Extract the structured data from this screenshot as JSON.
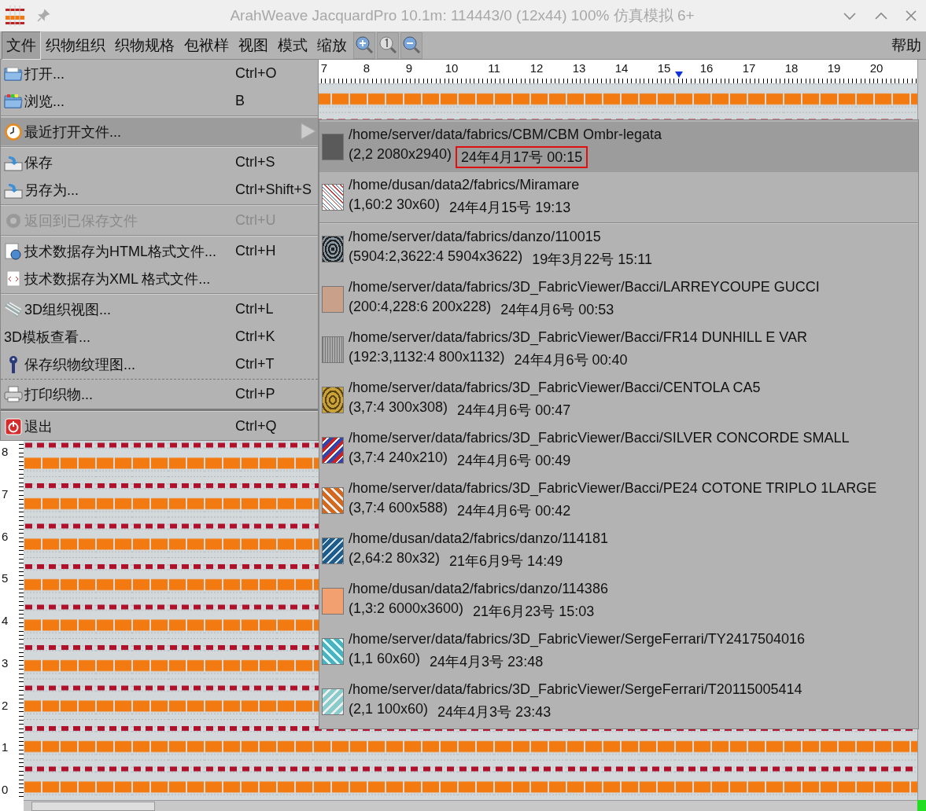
{
  "window": {
    "title": "ArahWeave JacquardPro 10.1m: 114443/0 (12x44) 100% 仿真模拟 6+"
  },
  "menubar": {
    "items": [
      {
        "label": "文件",
        "selected": true
      },
      {
        "label": "织物组织",
        "selected": false
      },
      {
        "label": "织物规格",
        "selected": false
      },
      {
        "label": "包袱样",
        "selected": false
      },
      {
        "label": "视图",
        "selected": false
      },
      {
        "label": "模式",
        "selected": false
      },
      {
        "label": "缩放",
        "selected": false
      }
    ],
    "help": "帮助"
  },
  "top_ruler": {
    "labels": [
      "7",
      "8",
      "9",
      "10",
      "11",
      "12",
      "13",
      "14",
      "15",
      "16",
      "17",
      "18",
      "19",
      "20"
    ]
  },
  "left_ruler": {
    "labels": [
      "8",
      "7",
      "6",
      "5",
      "4",
      "3",
      "2",
      "1",
      "0"
    ]
  },
  "file_menu": [
    {
      "kind": "item",
      "label": "打开...",
      "shortcut": "Ctrl+O",
      "disabled": false,
      "selected": false,
      "submenu": false
    },
    {
      "kind": "item",
      "label": "浏览...",
      "shortcut": "B",
      "disabled": false,
      "selected": false,
      "submenu": false
    },
    {
      "kind": "separator"
    },
    {
      "kind": "item",
      "label": "最近打开文件...",
      "disabled": false,
      "selected": true,
      "submenu": true
    },
    {
      "kind": "separator"
    },
    {
      "kind": "item",
      "label": "保存",
      "shortcut": "Ctrl+S",
      "disabled": false,
      "selected": false,
      "submenu": false
    },
    {
      "kind": "item",
      "label": "另存为...",
      "shortcut": "Ctrl+Shift+S",
      "disabled": false,
      "selected": false,
      "submenu": false
    },
    {
      "kind": "separator"
    },
    {
      "kind": "item",
      "label": "返回到已保存文件",
      "shortcut": "Ctrl+U",
      "disabled": true,
      "selected": false,
      "submenu": false
    },
    {
      "kind": "separator"
    },
    {
      "kind": "item",
      "label": "技术数据存为HTML格式文件...",
      "shortcut": "Ctrl+H",
      "disabled": false,
      "selected": false,
      "submenu": false
    },
    {
      "kind": "item",
      "label": "技术数据存为XML 格式文件...",
      "disabled": false,
      "selected": false,
      "submenu": false
    },
    {
      "kind": "separator"
    },
    {
      "kind": "item",
      "label": "3D组织视图...",
      "shortcut": "Ctrl+L",
      "disabled": false,
      "selected": false,
      "submenu": false
    },
    {
      "kind": "item",
      "label": "3D模板查看...",
      "shortcut": "Ctrl+K",
      "disabled": false,
      "selected": false,
      "submenu": false
    },
    {
      "kind": "item",
      "label": "保存织物纹理图...",
      "shortcut": "Ctrl+T",
      "disabled": false,
      "selected": false,
      "submenu": false
    },
    {
      "kind": "dashed-separator"
    },
    {
      "kind": "item",
      "label": "打印织物...",
      "shortcut": "Ctrl+P",
      "disabled": false,
      "selected": false,
      "submenu": false
    },
    {
      "kind": "heavy-separator"
    },
    {
      "kind": "item",
      "label": "退出",
      "shortcut": "Ctrl+Q",
      "disabled": false,
      "selected": false,
      "submenu": false
    }
  ],
  "recent_files": [
    {
      "path": "/home/server/data/fabrics/CBM/CBM Ombr-legata",
      "details": "(2,2 2080x2940)",
      "date": "24年4月17号 00:15",
      "selected": true,
      "marked": true,
      "divider_after": false
    },
    {
      "path": "/home/dusan/data2/fabrics/Miramare",
      "details": "(1,60:2 30x60)",
      "date": "24年4月15号 19:13",
      "selected": false,
      "marked": false,
      "divider_after": true
    },
    {
      "path": "/home/server/data/fabrics/danzo/110015",
      "details": "(5904:2,3622:4 5904x3622)",
      "date": "19年3月22号 15:11",
      "selected": false,
      "marked": false,
      "divider_after": false
    },
    {
      "path": "/home/server/data/fabrics/3D_FabricViewer/Bacci/LARREYCOUPE GUCCI",
      "details": "(200:4,228:6 200x228)",
      "date": "24年4月6号 00:53",
      "selected": false,
      "marked": false,
      "divider_after": false
    },
    {
      "path": "/home/server/data/fabrics/3D_FabricViewer/Bacci/FR14 DUNHILL E VAR",
      "details": "(192:3,1132:4 800x1132)",
      "date": "24年4月6号 00:40",
      "selected": false,
      "marked": false,
      "divider_after": false
    },
    {
      "path": "/home/server/data/fabrics/3D_FabricViewer/Bacci/CENTOLA CA5",
      "details": "(3,7:4 300x308)",
      "date": "24年4月6号 00:47",
      "selected": false,
      "marked": false,
      "divider_after": false
    },
    {
      "path": "/home/server/data/fabrics/3D_FabricViewer/Bacci/SILVER CONCORDE SMALL",
      "details": "(3,7:4 240x210)",
      "date": "24年4月6号 00:49",
      "selected": false,
      "marked": false,
      "divider_after": false
    },
    {
      "path": "/home/server/data/fabrics/3D_FabricViewer/Bacci/PE24 COTONE TRIPLO 1LARGE",
      "details": "(3,7:4 600x588)",
      "date": "24年4月6号 00:42",
      "selected": false,
      "marked": false,
      "divider_after": false
    },
    {
      "path": "/home/dusan/data2/fabrics/danzo/114181",
      "details": "(2,64:2 80x32)",
      "date": "21年6月9号 14:49",
      "selected": false,
      "marked": false,
      "divider_after": false
    },
    {
      "path": "/home/dusan/data2/fabrics/danzo/114386",
      "details": "(1,3:2 6000x3600)",
      "date": "21年6月23号 15:03",
      "selected": false,
      "marked": false,
      "divider_after": false
    },
    {
      "path": "/home/server/data/fabrics/3D_FabricViewer/SergeFerrari/TY2417504016",
      "details": "(1,1 60x60)",
      "date": "24年4月3号 23:48",
      "selected": false,
      "marked": false,
      "divider_after": false
    },
    {
      "path": "/home/server/data/fabrics/3D_FabricViewer/SergeFerrari/T20115005414",
      "details": "(2,1 100x60)",
      "date": "24年4月3号 23:43",
      "selected": false,
      "marked": false,
      "divider_after": false
    }
  ]
}
